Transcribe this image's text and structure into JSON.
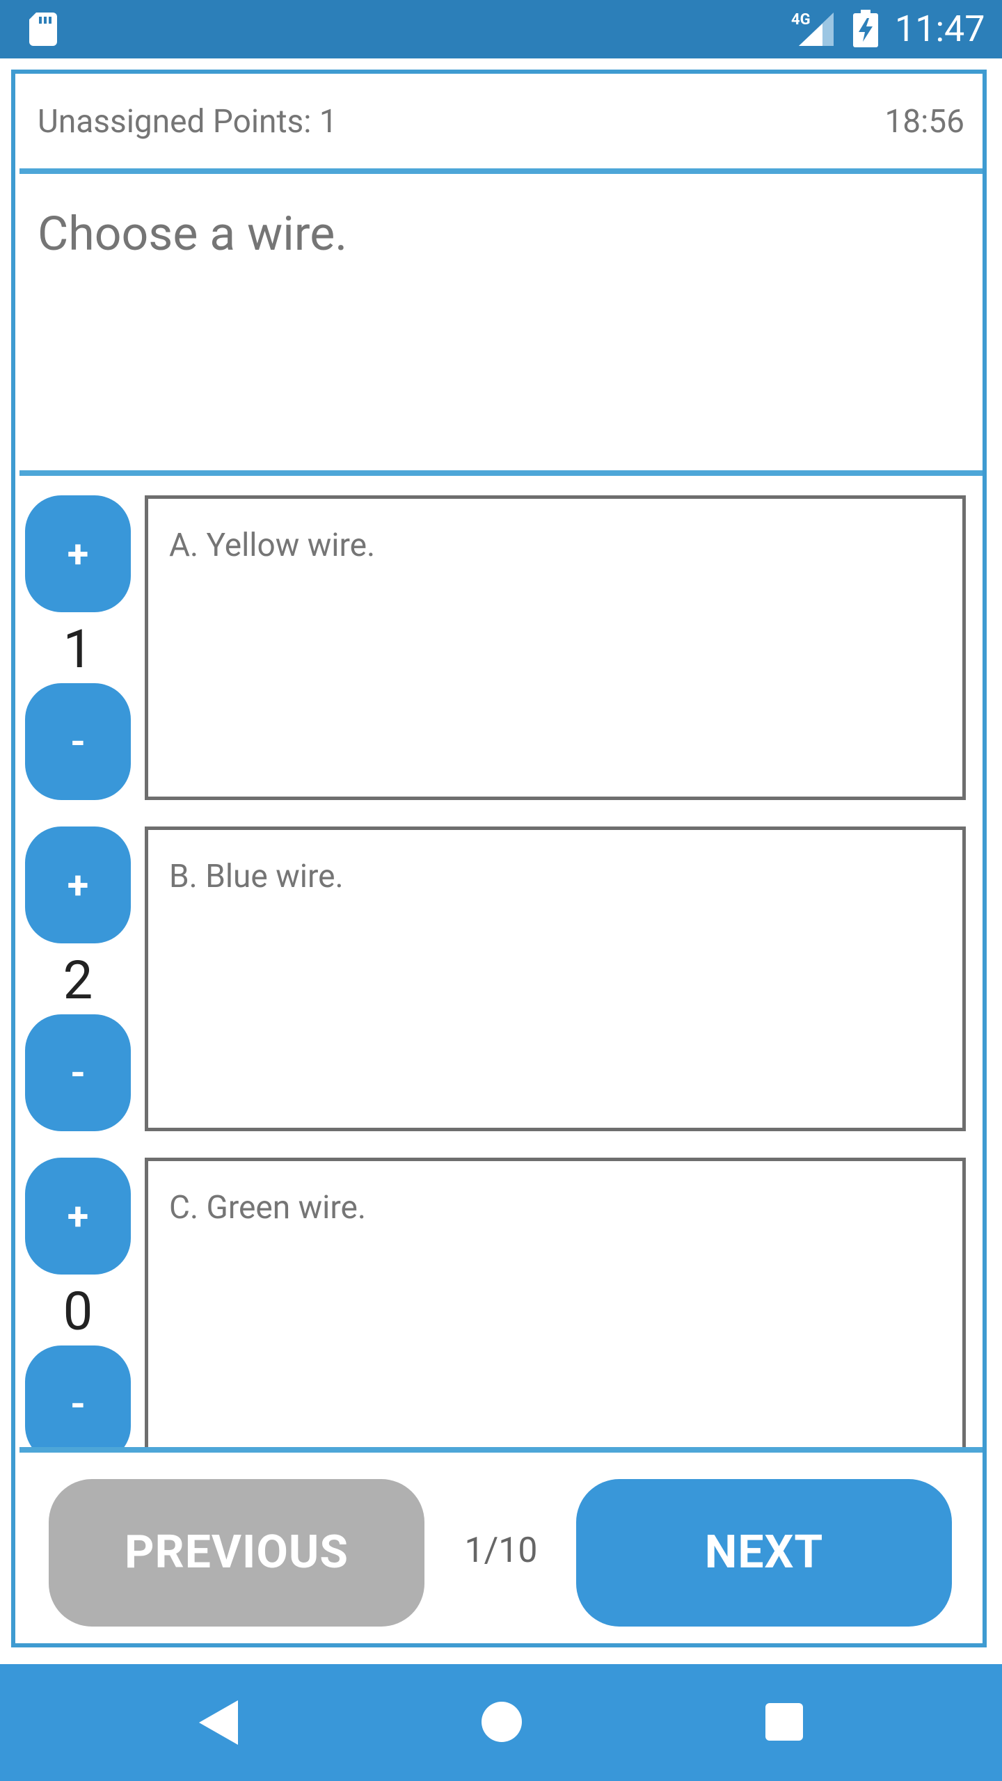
{
  "status_bar": {
    "network_label": "4G",
    "time": "11:47",
    "icons": [
      "sd-card-icon",
      "cellular-signal-icon",
      "battery-charging-icon"
    ]
  },
  "header": {
    "unassigned_label": "Unassigned Points:",
    "unassigned_value": "1",
    "timer": "18:56"
  },
  "question": {
    "text": "Choose a wire."
  },
  "answers": [
    {
      "label": "A. Yellow wire.",
      "score": "1",
      "plus_label": "+",
      "minus_label": "-"
    },
    {
      "label": "B. Blue wire.",
      "score": "2",
      "plus_label": "+",
      "minus_label": "-"
    },
    {
      "label": "C. Green wire.",
      "score": "0",
      "plus_label": "+",
      "minus_label": "-"
    }
  ],
  "navigation": {
    "previous_label": "PREVIOUS",
    "next_label": "NEXT",
    "page_indicator": "1/10"
  },
  "system_nav": {
    "icons": [
      "back-icon",
      "home-icon",
      "recent-apps-icon"
    ]
  },
  "colors": {
    "status_bar": "#2c7fb9",
    "accent": "#3997d9",
    "frame_border": "#4da6d8",
    "disabled_button": "#b0b0b0"
  }
}
